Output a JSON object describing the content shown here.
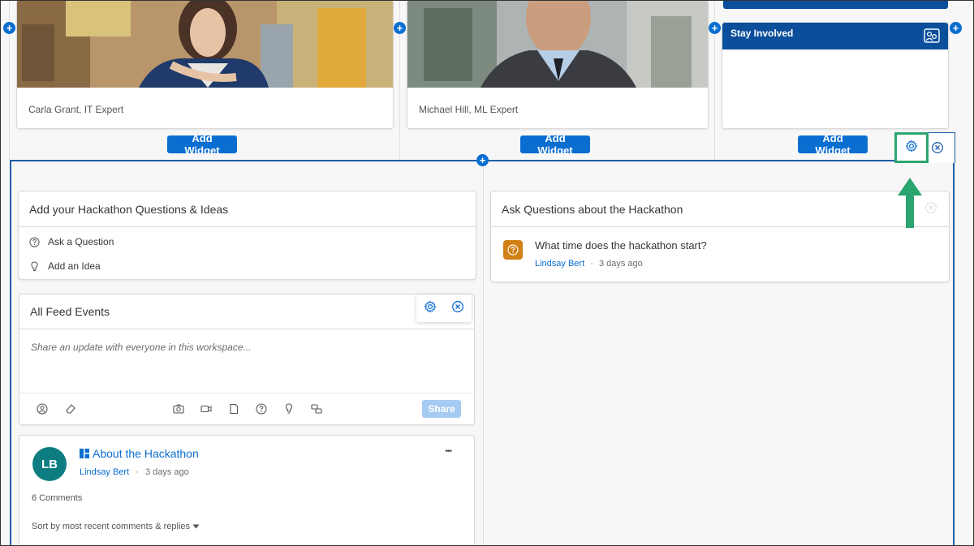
{
  "top_row": {
    "profile_1": {
      "caption": "Carla Grant, IT Expert"
    },
    "profile_2": {
      "caption": "Michael Hill, ML Expert"
    },
    "stay_involved": {
      "title": "Stay Involved"
    },
    "add_widget_label": "Add Widget",
    "plus_label": "+"
  },
  "questions_panel": {
    "title": "Add your Hackathon Questions & Ideas",
    "items": [
      {
        "label": "Ask a Question",
        "icon": "question-circle-icon"
      },
      {
        "label": "Add an Idea",
        "icon": "lightbulb-icon"
      }
    ]
  },
  "feed_panel": {
    "title": "All Feed Events",
    "placeholder": "Share an update with everyone in this workspace...",
    "share_label": "Share"
  },
  "post": {
    "avatar_initials": "LB",
    "title": "About the Hackathon",
    "author": "Lindsay Bert",
    "separator": "·",
    "time": "3 days ago",
    "comments": "6 Comments",
    "sort_label": "Sort by most recent comments & replies",
    "more_label": "•••"
  },
  "ask_panel": {
    "title": "Ask Questions about the Hackathon",
    "question": "What time does the hackathon start?",
    "author": "Lindsay Bert",
    "separator": "·",
    "time": "3 days ago"
  },
  "colors": {
    "accent": "#0a6ed1",
    "section_border": "#1f5fa8",
    "highlight": "#2aa56f",
    "avatar": "#0e7d82",
    "question_badge": "#d08014",
    "stay_header": "#0b4f9c"
  }
}
